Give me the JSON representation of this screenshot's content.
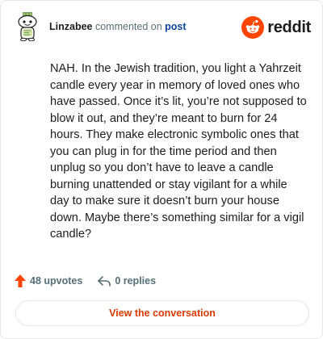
{
  "header": {
    "username": "Linzabee",
    "action_text": " commented on ",
    "post_link": "post",
    "brand_name": "reddit",
    "brand_color": "#ff4500"
  },
  "comment": {
    "body": "NAH. In the Jewish tradition, you light a Yahrzeit candle every year in memory of loved ones who have passed. Once it’s lit, you’re not supposed to blow it out, and they’re meant to burn for 24 hours. They make electronic symbolic ones that you can plug in for the time period and then unplug so you don’t have to leave a candle burning unattended or stay vigilant for a while day to make sure it doesn’t burn your house down. Maybe there’s something similar for a vigil candle?"
  },
  "stats": {
    "upvotes_label": "48 upvotes",
    "replies_label": "0 replies",
    "upvote_icon": "upvote-arrow-icon",
    "reply_icon": "reply-arrow-icon"
  },
  "cta": {
    "label": "View the conversation"
  },
  "colors": {
    "accent": "#d93900",
    "muted": "#576f76",
    "text": "#1c1c1c",
    "link": "#0a449b"
  }
}
